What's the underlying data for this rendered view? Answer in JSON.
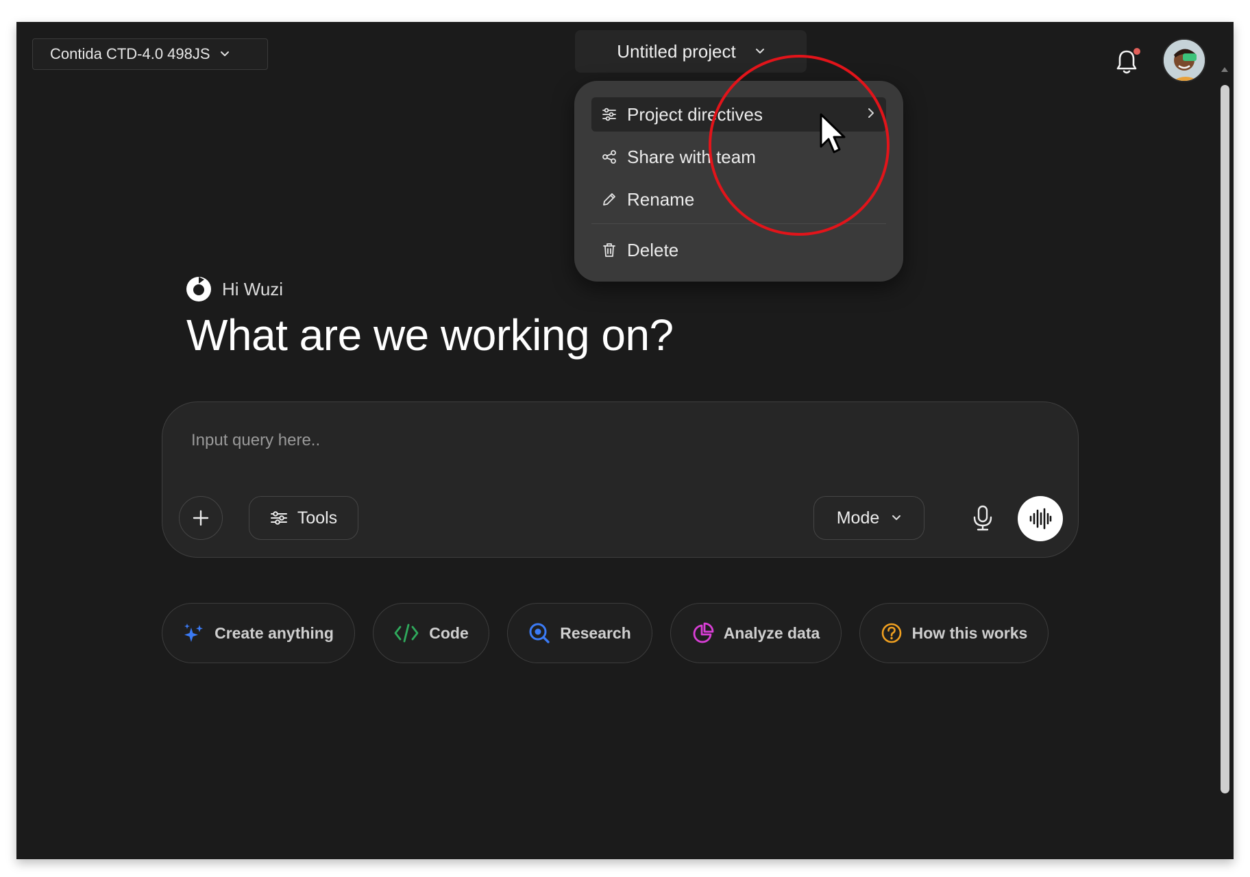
{
  "header": {
    "model_selector": {
      "label": "Contida CTD-4.0 498JS",
      "icon": "chevron-down-icon"
    },
    "project_selector": {
      "label": "Untitled project",
      "icon": "chevron-down-icon"
    },
    "notifications": {
      "icon": "bell-icon",
      "has_unread": true,
      "dot_color": "#e2605a"
    },
    "avatar": {
      "icon": "user-avatar"
    }
  },
  "project_menu": {
    "items": [
      {
        "label": "Project directives",
        "icon": "sliders-icon",
        "has_submenu": true,
        "highlighted": true
      },
      {
        "label": "Share with team",
        "icon": "share-icon"
      },
      {
        "label": "Rename",
        "icon": "pencil-icon"
      },
      {
        "label": "Delete",
        "icon": "trash-icon"
      }
    ]
  },
  "annotation": {
    "circle_color": "#e2141a",
    "cursor": "pointer-cursor"
  },
  "greeting": {
    "text": "Hi Wuzi",
    "icon": "app-logo"
  },
  "headline": "What are we working on?",
  "composer": {
    "placeholder": "Input query here..",
    "value": "",
    "add_icon": "plus-icon",
    "tools_label": "Tools",
    "tools_icon": "sliders-icon",
    "mode_label": "Mode",
    "mic_icon": "microphone-icon",
    "voice_icon": "voice-wave-icon"
  },
  "quick_actions": [
    {
      "label": "Create anything",
      "icon": "sparkle-icon",
      "color": "#3b7bf6"
    },
    {
      "label": "Code",
      "icon": "code-icon",
      "color": "#2faa5c"
    },
    {
      "label": "Research",
      "icon": "search-icon",
      "color": "#3b7bf6"
    },
    {
      "label": "Analyze data",
      "icon": "pie-chart-icon",
      "color": "#d93fd6"
    },
    {
      "label": "How this works",
      "icon": "question-icon",
      "color": "#f0a020"
    }
  ],
  "theme": {
    "background": "#1b1b1b",
    "panel": "#262626",
    "menu": "#3a3a3a"
  }
}
